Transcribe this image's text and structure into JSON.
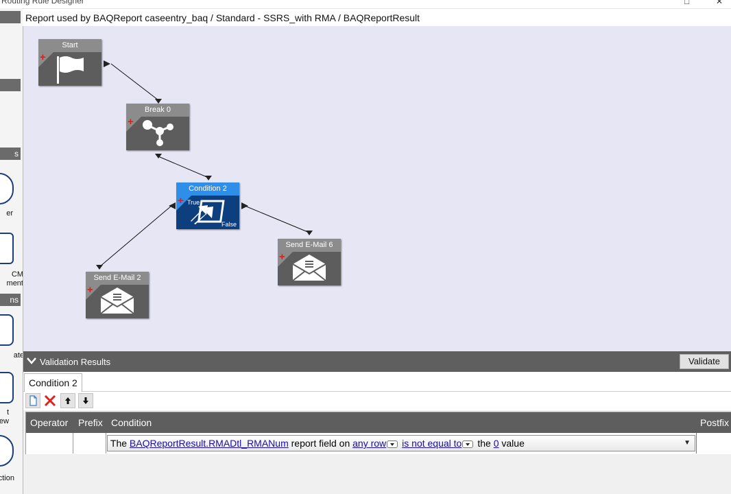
{
  "window": {
    "title": "Routing Rule Designer",
    "controls": [
      "□",
      "✕"
    ]
  },
  "toolbox": {
    "headers": [
      "",
      "",
      "s",
      "ns"
    ],
    "items": [
      {
        "label": "er",
        "icon": "filter-icon"
      },
      {
        "label": "CM\nment",
        "icon": "document-icon"
      },
      {
        "label": "ate",
        "icon": "template-icon"
      },
      {
        "label": "t\nview",
        "icon": "preview-icon"
      },
      {
        "label": "ction",
        "icon": "user-icon"
      }
    ]
  },
  "breadcrumb": "Report used by BAQReport caseentry_baq / Standard - SSRS_with RMA / BAQReportResult",
  "workflow": {
    "nodes": [
      {
        "id": "start",
        "title": "Start",
        "icon": "flag-icon"
      },
      {
        "id": "break0",
        "title": "Break 0",
        "icon": "branch-icon"
      },
      {
        "id": "cond2",
        "title": "Condition 2",
        "icon": "condition-arrows-icon",
        "true_label": "True",
        "false_label": "False",
        "selected": true
      },
      {
        "id": "mail6",
        "title": "Send E-Mail 6",
        "icon": "envelope-icon"
      },
      {
        "id": "mail2",
        "title": "Send E-Mail 2",
        "icon": "envelope-icon"
      }
    ],
    "add_marker": "+"
  },
  "validation": {
    "title": "Validation Results",
    "button": "Validate"
  },
  "tabs": [
    {
      "label": "Condition 2",
      "active": true
    }
  ],
  "toolbar": [
    "new-icon",
    "delete-icon",
    "move-up-icon",
    "move-down-icon"
  ],
  "grid": {
    "columns": [
      "Operator",
      "Prefix",
      "Condition",
      "Postfix"
    ],
    "row": {
      "t1": "The",
      "field": "BAQReportResult.RMADtl_RMANum",
      "t2": "report field on",
      "scope": "any row",
      "op": "is not equal to",
      "t3": "the",
      "val": "0",
      "t4": "value"
    }
  },
  "colors": {
    "canvas": "#e6e6f5",
    "node": "#5d5d5d",
    "selected_node": "#0d3f7e",
    "selected_header": "#2e8ee8",
    "header_bar": "#5e5e5e",
    "link": "#1a0dab"
  }
}
